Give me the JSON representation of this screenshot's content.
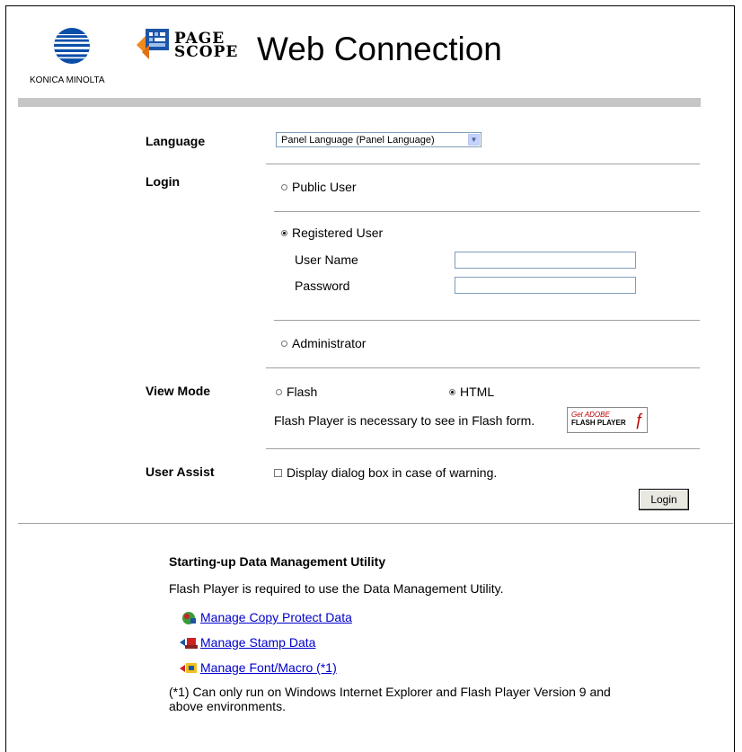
{
  "header": {
    "brand": "KONICA MINOLTA",
    "pagescope_line1": "PAGE",
    "pagescope_line2": "SCOPE",
    "title": "Web Connection"
  },
  "language": {
    "label": "Language",
    "selected": "Panel Language (Panel Language)"
  },
  "login": {
    "label": "Login",
    "public_user": "Public User",
    "registered_user": "Registered User",
    "user_name_label": "User Name",
    "user_name_value": "",
    "password_label": "Password",
    "password_value": "",
    "administrator": "Administrator",
    "selected": "registered_user"
  },
  "view_mode": {
    "label": "View Mode",
    "flash": "Flash",
    "html": "HTML",
    "selected": "html",
    "note": "Flash Player is necessary to see in Flash form.",
    "badge_line1": "Get ADOBE",
    "badge_line2": "FLASH PLAYER"
  },
  "user_assist": {
    "label": "User Assist",
    "checkbox_label": "Display dialog box in case of warning.",
    "checked": false
  },
  "login_button": "Login",
  "data_mgmt": {
    "heading": "Starting-up Data Management Utility",
    "note": "Flash Player is required to use the Data Management Utility.",
    "links": [
      {
        "label": "Manage Copy Protect Data",
        "icon": "copy-protect-icon"
      },
      {
        "label": "Manage Stamp Data",
        "icon": "stamp-icon"
      },
      {
        "label": "Manage Font/Macro (*1)",
        "icon": "font-macro-icon"
      }
    ],
    "footnote_line1": "(*1) Can only run on Windows Internet Explorer and Flash Player Version 9 and",
    "footnote_line2": "above environments."
  },
  "colors": {
    "link": "#0000cc",
    "gray_bar": "#c6c6c6",
    "konica_blue": "#0a4ea8",
    "pagescope_orange": "#f08a1c"
  }
}
